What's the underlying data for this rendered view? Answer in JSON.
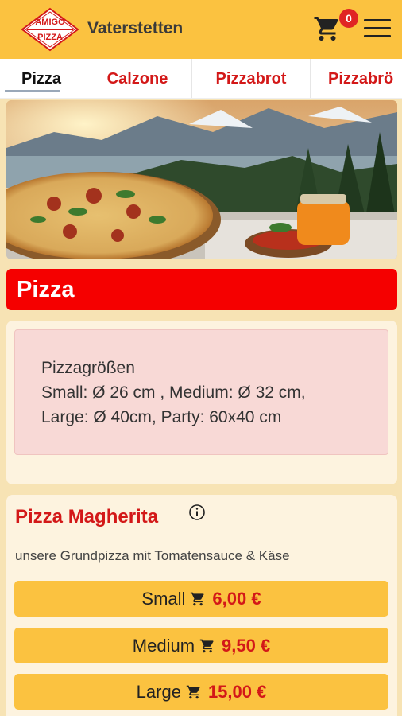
{
  "header": {
    "logo_text_top": "AMIGO",
    "logo_text_bottom": "PIZZA",
    "city": "Vaterstetten",
    "cart_count": "0"
  },
  "tabs": [
    {
      "label": "Pizza",
      "active": true
    },
    {
      "label": "Calzone",
      "active": false
    },
    {
      "label": "Pizzabrot",
      "active": false
    },
    {
      "label": "Pizzabrö",
      "active": false
    }
  ],
  "section": {
    "title": "Pizza"
  },
  "info": {
    "line1": "Pizzagrößen",
    "line2": "Small: Ø 26 cm , Medium: Ø 32 cm,",
    "line3": "Large: Ø 40cm, Party: 60x40 cm"
  },
  "product": {
    "name": "Pizza Magherita",
    "description": "unsere Grundpizza mit Tomatensauce & Käse",
    "sizes": [
      {
        "label": "Small",
        "price": "6,00 €"
      },
      {
        "label": "Medium",
        "price": "9,50 €"
      },
      {
        "label": "Large",
        "price": "15,00 €"
      }
    ]
  },
  "colors": {
    "brand_yellow": "#fbc240",
    "brand_red": "#d31818",
    "title_red": "#f50000"
  },
  "icons": [
    "cart-icon",
    "hamburger-menu-icon",
    "info-icon"
  ]
}
